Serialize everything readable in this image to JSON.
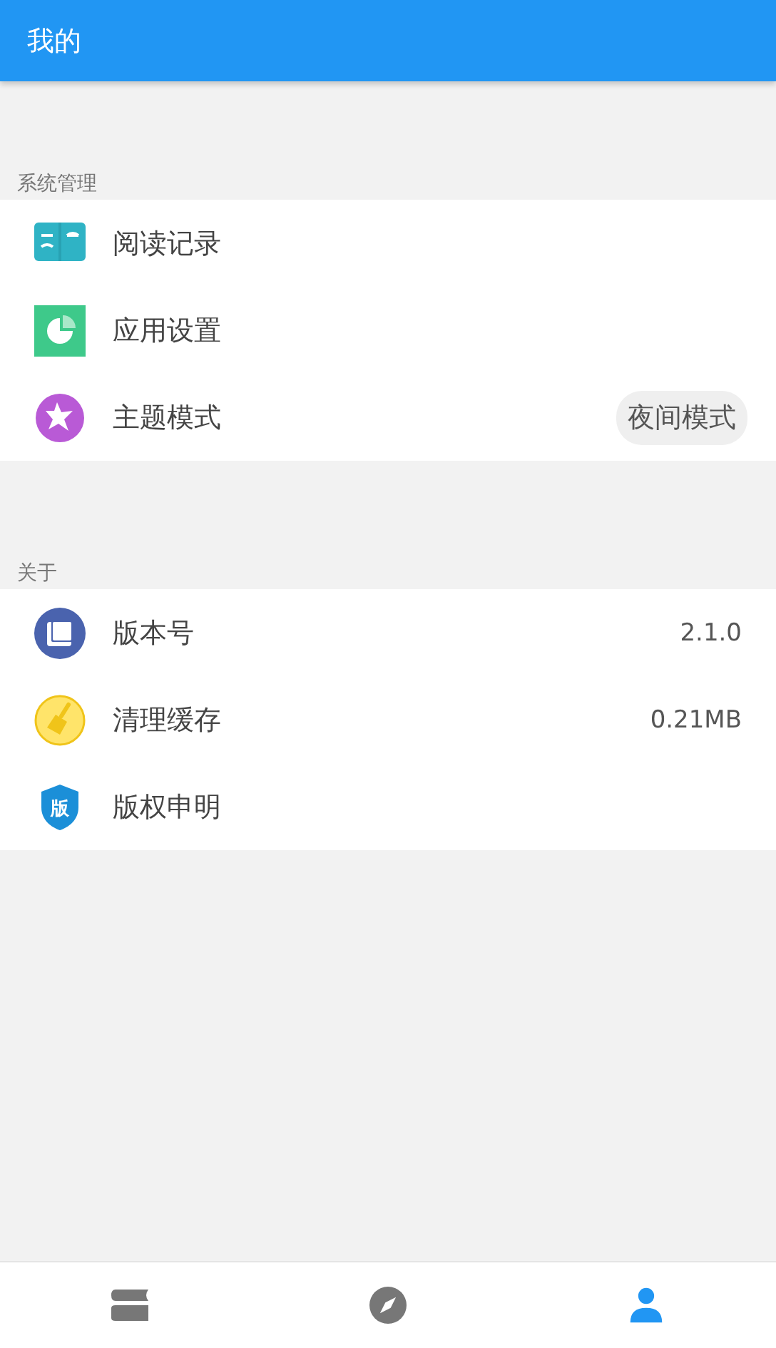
{
  "app_bar": {
    "title": "我的"
  },
  "sections": [
    {
      "title": "系统管理",
      "items": [
        {
          "kind": "book",
          "label": "阅读记录"
        },
        {
          "kind": "pie",
          "label": "应用设置"
        },
        {
          "kind": "star",
          "label": "主题模式",
          "chip": "夜间模式"
        }
      ]
    },
    {
      "title": "关于",
      "items": [
        {
          "kind": "copy",
          "label": "版本号",
          "value": "2.1.0"
        },
        {
          "kind": "broom",
          "label": "清理缓存",
          "value": "0.21MB"
        },
        {
          "kind": "shield",
          "label": "版权申明",
          "icon_text": "版"
        }
      ]
    }
  ],
  "bottom_nav": [
    {
      "kind": "books",
      "selected": false
    },
    {
      "kind": "compass",
      "selected": false
    },
    {
      "kind": "person",
      "selected": true
    }
  ]
}
